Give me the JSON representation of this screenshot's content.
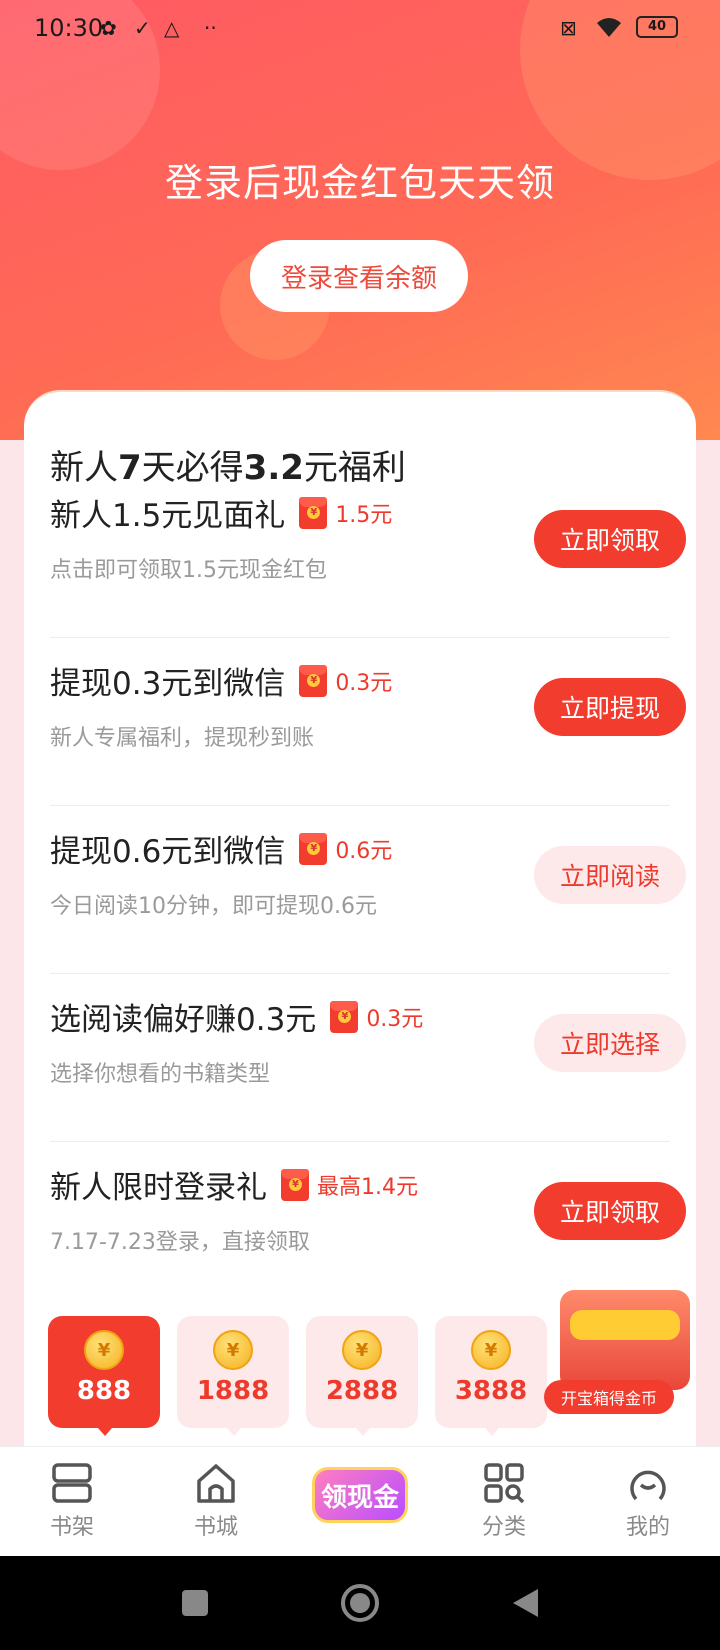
{
  "status_bar": {
    "time": "10:30",
    "battery": "40"
  },
  "hero": {
    "title": "登录后现金红包天天领",
    "login_button": "登录查看余额"
  },
  "card": {
    "title_prefix": "新人",
    "title_bold1": "7",
    "title_mid": "天必得",
    "title_bold2": "3.2",
    "title_suffix": "元福利"
  },
  "tasks": [
    {
      "title": "新人1.5元见面礼",
      "amount": "1.5元",
      "subtitle": "点击即可领取1.5元现金红包",
      "button": "立即领取",
      "button_style": "solid"
    },
    {
      "title": "提现0.3元到微信",
      "amount": "0.3元",
      "subtitle": "新人专属福利，提现秒到账",
      "button": "立即提现",
      "button_style": "solid"
    },
    {
      "title": "提现0.6元到微信",
      "amount": "0.6元",
      "subtitle": "今日阅读10分钟，即可提现0.6元",
      "button": "立即阅读",
      "button_style": "soft"
    },
    {
      "title": "选阅读偏好赚0.3元",
      "amount": "0.3元",
      "subtitle": "选择你想看的书籍类型",
      "button": "立即选择",
      "button_style": "soft"
    },
    {
      "title": "新人限时登录礼",
      "amount": "最高1.4元",
      "subtitle": "7.17-7.23登录，直接领取",
      "button": "立即领取",
      "button_style": "solid"
    }
  ],
  "coins": [
    {
      "value": "888",
      "active": true
    },
    {
      "value": "1888",
      "active": false
    },
    {
      "value": "2888",
      "active": false
    },
    {
      "value": "3888",
      "active": false
    }
  ],
  "coin_symbol": "¥",
  "chest": {
    "label": "开宝箱得金币"
  },
  "tabbar": {
    "bookshelf": "书架",
    "bookstore": "书城",
    "cash_badge": "领现金",
    "category": "分类",
    "mine": "我的"
  },
  "colors": {
    "accent": "#f23c2e",
    "hero_gradient_start": "#ff5a63",
    "soft_button_bg": "#fde9ea"
  }
}
